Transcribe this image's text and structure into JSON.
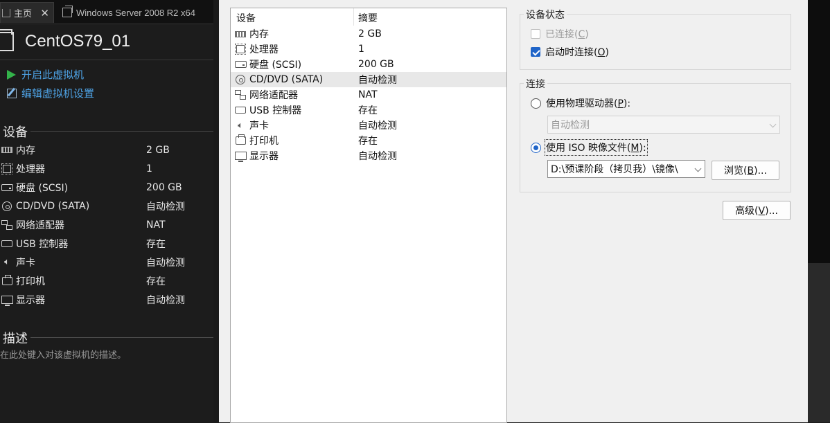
{
  "tabs": [
    {
      "label": "主页"
    },
    {
      "label": "Windows Server 2008 R2 x64"
    }
  ],
  "vm": {
    "name": "CentOS79_01",
    "actions": [
      {
        "label": "开启此虚拟机",
        "icon": "play-icon"
      },
      {
        "label": "编辑虚拟机设置",
        "icon": "edit-settings-icon"
      }
    ]
  },
  "left_panel": {
    "devices_heading": "设备",
    "devices": [
      {
        "name": "内存",
        "value": "2 GB",
        "icon": "memory-icon"
      },
      {
        "name": "处理器",
        "value": "1",
        "icon": "processor-icon"
      },
      {
        "name": "硬盘 (SCSI)",
        "value": "200 GB",
        "icon": "hard-disk-icon"
      },
      {
        "name": "CD/DVD (SATA)",
        "value": "自动检测",
        "icon": "cd-dvd-icon"
      },
      {
        "name": "网络适配器",
        "value": "NAT",
        "icon": "network-adapter-icon"
      },
      {
        "name": "USB 控制器",
        "value": "存在",
        "icon": "usb-icon"
      },
      {
        "name": "声卡",
        "value": "自动检测",
        "icon": "sound-icon"
      },
      {
        "name": "打印机",
        "value": "存在",
        "icon": "printer-icon"
      },
      {
        "name": "显示器",
        "value": "自动检测",
        "icon": "display-icon"
      }
    ],
    "description_heading": "描述",
    "description_placeholder": "在此处键入对该虚拟机的描述。"
  },
  "device_list": {
    "col_device": "设备",
    "col_summary": "摘要",
    "selected_index": 3,
    "rows": [
      {
        "name": "内存",
        "value": "2 GB",
        "icon": "memory-icon"
      },
      {
        "name": "处理器",
        "value": "1",
        "icon": "processor-icon"
      },
      {
        "name": "硬盘 (SCSI)",
        "value": "200 GB",
        "icon": "hard-disk-icon"
      },
      {
        "name": "CD/DVD (SATA)",
        "value": "自动检测",
        "icon": "cd-dvd-icon"
      },
      {
        "name": "网络适配器",
        "value": "NAT",
        "icon": "network-adapter-icon"
      },
      {
        "name": "USB 控制器",
        "value": "存在",
        "icon": "usb-icon"
      },
      {
        "name": "声卡",
        "value": "自动检测",
        "icon": "sound-icon"
      },
      {
        "name": "打印机",
        "value": "存在",
        "icon": "printer-icon"
      },
      {
        "name": "显示器",
        "value": "自动检测",
        "icon": "display-icon"
      }
    ]
  },
  "device_status": {
    "title": "设备状态",
    "connected_label": "已连接(",
    "connected_key": "C",
    "connected_checked": false,
    "connected_enabled": false,
    "connect_on_start_label": "启动时连接(",
    "connect_on_start_key": "O",
    "connect_on_start_checked": true
  },
  "connection": {
    "title": "连接",
    "physical_label": "使用物理驱动器(",
    "physical_key": "P",
    "physical_selected": false,
    "physical_drive_value": "自动检测",
    "iso_label": "使用 ISO 映像文件(",
    "iso_key": "M",
    "iso_selected": true,
    "iso_path": "D:\\预课阶段（拷贝我）\\镜像\\",
    "browse_label": "浏览(",
    "browse_key": "B"
  },
  "advanced": {
    "label": "高级(",
    "key": "V"
  }
}
